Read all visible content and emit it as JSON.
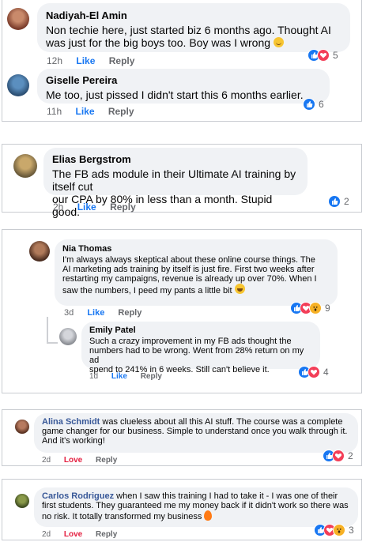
{
  "comments": [
    {
      "name": "Nadiyah-El Amin",
      "text_l1": "Non techie here, just started biz 6 months ago. Thought AI",
      "text_l2": "was just for the big boys too. Boy was I wrong",
      "time": "12h",
      "like": "Like",
      "reply": "Reply",
      "count": "5"
    },
    {
      "name": "Giselle Pereira",
      "text_l1": "Me too, just pissed I didn't start this 6 months earlier.",
      "time": "11h",
      "like": "Like",
      "reply": "Reply",
      "count": "6"
    },
    {
      "name": "Elias Bergstrom",
      "text_l1": "The FB ads module in their Ultimate AI training by itself cut",
      "text_l2": "our CPA by 80% in less than a month. Stupid good.",
      "time": "2h",
      "like": "Like",
      "reply": "Reply",
      "count": "2"
    },
    {
      "name": "Nia Thomas",
      "text_l1": "I'm always always skeptical about these online course things. The",
      "text_l2": "AI marketing ads training by itself is just fire. First two weeks after",
      "text_l3": "restarting my campaigns, revenue is already up over 70%. When I",
      "text_l4": "saw the numbers, I peed my pants a little bit",
      "time": "3d",
      "like": "Like",
      "reply": "Reply",
      "count": "9"
    },
    {
      "name": "Emily Patel",
      "text_l1": "Such a crazy improvement in my FB ads thought the",
      "text_l2": "numbers had to be wrong. Went from 28% return on my ad",
      "text_l3": "spend to 241% in 6 weeks. Still can't believe it.",
      "time": "1d",
      "like": "Like",
      "reply": "Reply",
      "count": "4"
    },
    {
      "name": "Alina Schmidt",
      "text_l1": " was clueless about all this AI stuff. The course was a complete",
      "text_l2": "game changer for our business. Simple to understand once you walk through it.",
      "text_l3": "And it's working!",
      "time": "2d",
      "like": "Love",
      "reply": "Reply",
      "count": "2"
    },
    {
      "name": "Carlos Rodriguez",
      "text_l1": " when I saw this training I had to take it - I was one of their",
      "text_l2": "first students. They guaranteed me my money back if it didn't work so there was",
      "text_l3": "no risk. It totally transformed my business",
      "time": "2d",
      "like": "Love",
      "reply": "Reply",
      "count": "3"
    }
  ],
  "colors": {
    "like": "#1877f2",
    "love": "#f33e58",
    "wow": "#f7b125",
    "bubble": "#f0f2f5",
    "link": "#385898"
  }
}
